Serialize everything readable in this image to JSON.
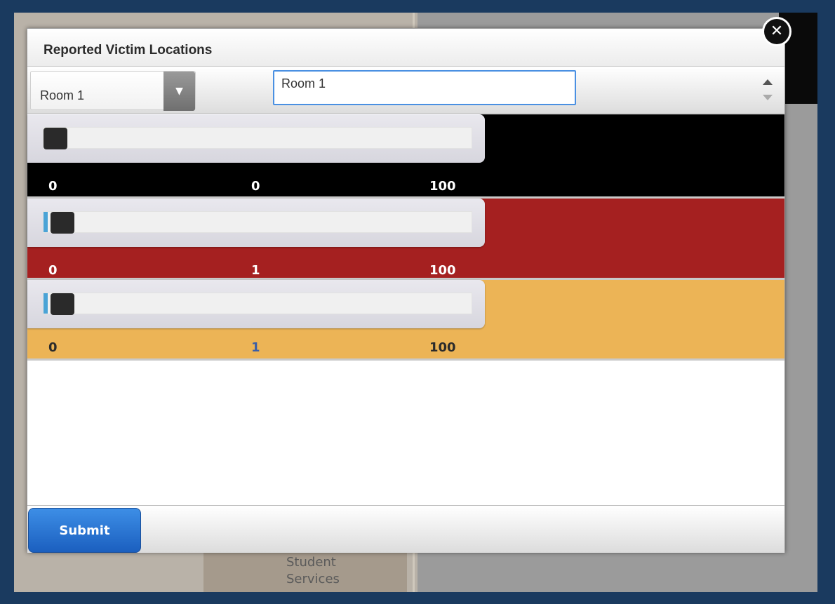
{
  "background": {
    "map_label": "Student\nServices"
  },
  "dialog": {
    "title": "Reported Victim Locations",
    "room_select": {
      "selected": "Room 1"
    },
    "room_name_input": {
      "value": "Room 1"
    },
    "sliders": [
      {
        "color": "#000000",
        "min": "0",
        "value": "0",
        "max": "100",
        "fill_fraction": 0.0
      },
      {
        "color": "#a52020",
        "min": "0",
        "value": "1",
        "max": "100",
        "fill_fraction": 0.01
      },
      {
        "color": "#ecb456",
        "min": "0",
        "value": "1",
        "max": "100",
        "fill_fraction": 0.01
      }
    ],
    "submit_label": "Submit"
  },
  "icons": {
    "close": "close-icon",
    "dropdown": "chevron-down-icon",
    "spinner_up": "caret-up-icon",
    "spinner_down": "caret-down-icon"
  },
  "colors": {
    "page_background": "#1a3a5f",
    "accent": "#4a90e2",
    "submit": "#2a75d6"
  }
}
